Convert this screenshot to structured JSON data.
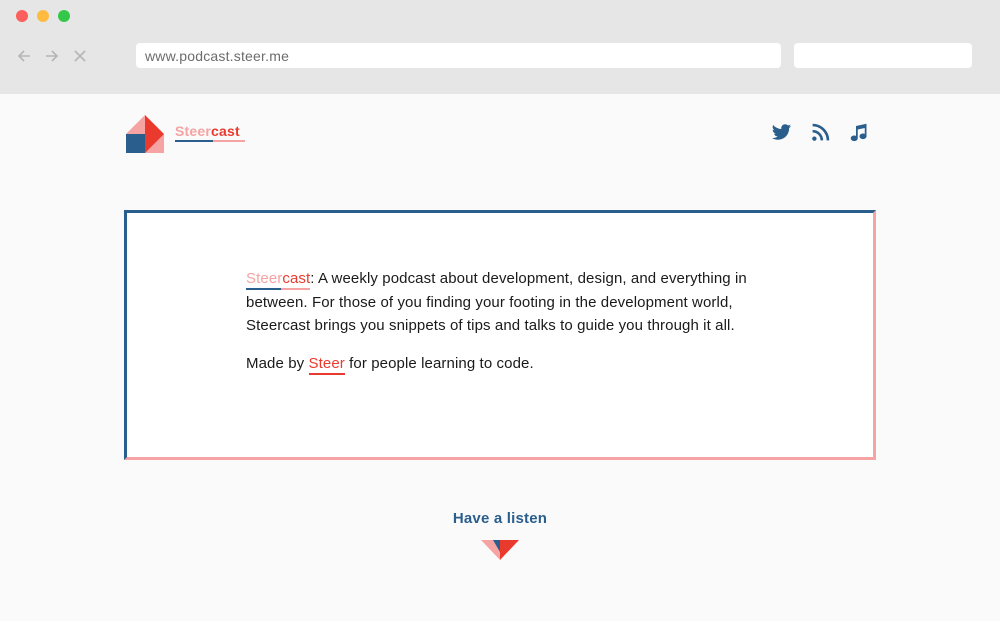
{
  "browser": {
    "url": "www.podcast.steer.me",
    "search_placeholder": ""
  },
  "header": {
    "brand_part1": "Steer",
    "brand_part2": "cast",
    "social_icons": [
      "twitter-icon",
      "rss-icon",
      "music-note-icon"
    ]
  },
  "card": {
    "brand_part1": "Steer",
    "brand_part2": "cast",
    "description": ": A weekly podcast about development, design, and everything in between. For those of you finding your footing in the development world, Steercast brings you snippets of tips and talks to guide you through it all.",
    "made_by_prefix": "Made by ",
    "made_by_link": "Steer",
    "made_by_suffix": " for people learning to code."
  },
  "cta": {
    "label": "Have a listen"
  },
  "colors": {
    "navy": "#2a5e8c",
    "pink": "#f5a3a3",
    "red": "#ea3a2e"
  }
}
